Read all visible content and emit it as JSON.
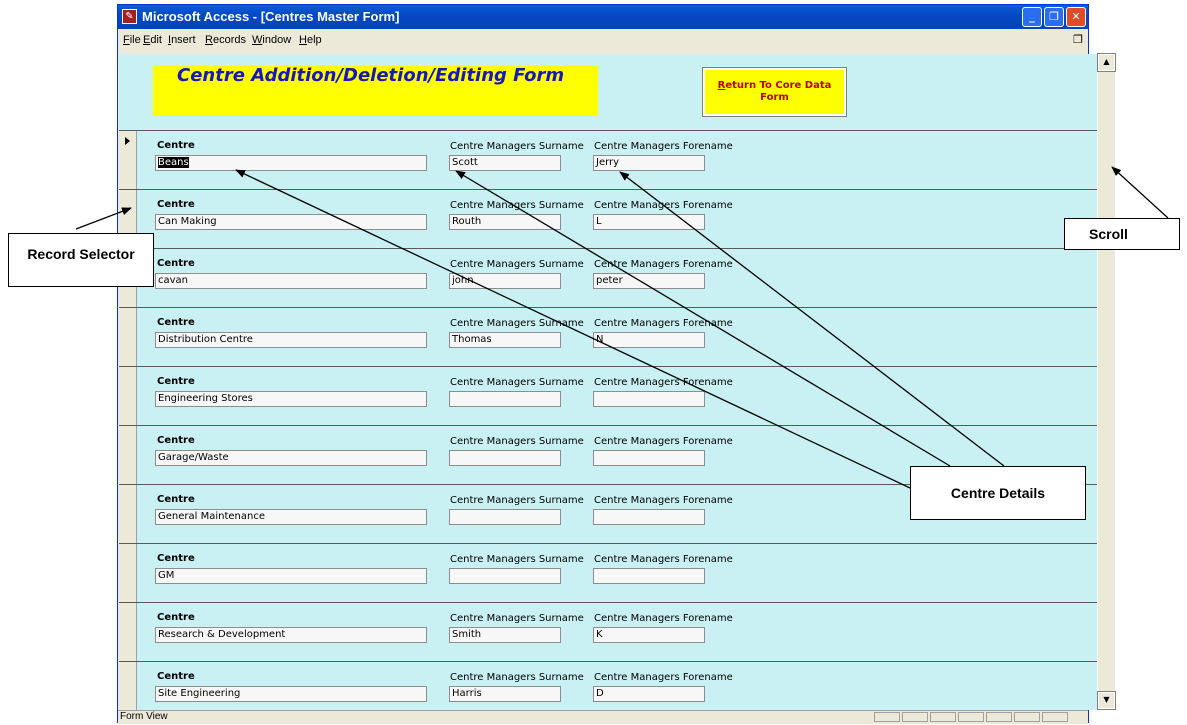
{
  "window": {
    "title": "Microsoft Access - [Centres Master Form]",
    "app_icon": "access-icon",
    "controls": {
      "minimize": "minimize-icon",
      "restore": "restore-icon",
      "close": "close-icon"
    }
  },
  "menu": {
    "items": [
      "File",
      "Edit",
      "Insert",
      "Records",
      "Window",
      "Help"
    ],
    "restore_doc": "restore-document-icon"
  },
  "form": {
    "header_title": "Centre Addition/Deletion/Editing Form",
    "return_button": "Return To Core Data Form",
    "labels": {
      "centre": "Centre",
      "surname": "Centre Managers Surname",
      "forename": "Centre Managers Forename"
    },
    "records": [
      {
        "centre": "Beans",
        "surname": "Scott",
        "forename": "Jerry"
      },
      {
        "centre": "Can Making",
        "surname": "Routh",
        "forename": "L"
      },
      {
        "centre": "cavan",
        "surname": "john",
        "forename": "peter"
      },
      {
        "centre": "Distribution Centre",
        "surname": "Thomas",
        "forename": "N"
      },
      {
        "centre": "Engineering Stores",
        "surname": "",
        "forename": ""
      },
      {
        "centre": "Garage/Waste",
        "surname": "",
        "forename": ""
      },
      {
        "centre": "General Maintenance",
        "surname": "",
        "forename": ""
      },
      {
        "centre": "GM",
        "surname": "",
        "forename": ""
      },
      {
        "centre": "Research & Development",
        "surname": "Smith",
        "forename": "K"
      },
      {
        "centre": "Site Engineering",
        "surname": "Harris",
        "forename": "D"
      }
    ]
  },
  "status": {
    "text": "Form View"
  },
  "annotations": {
    "record_selector": "Record Selector",
    "scroll": "Scroll",
    "centre_details": "Centre Details"
  },
  "colors": {
    "form_bg": "#c9f1f3",
    "banner": "#ffff00",
    "title_blue": "#1717c0",
    "button_text": "#c00000"
  }
}
